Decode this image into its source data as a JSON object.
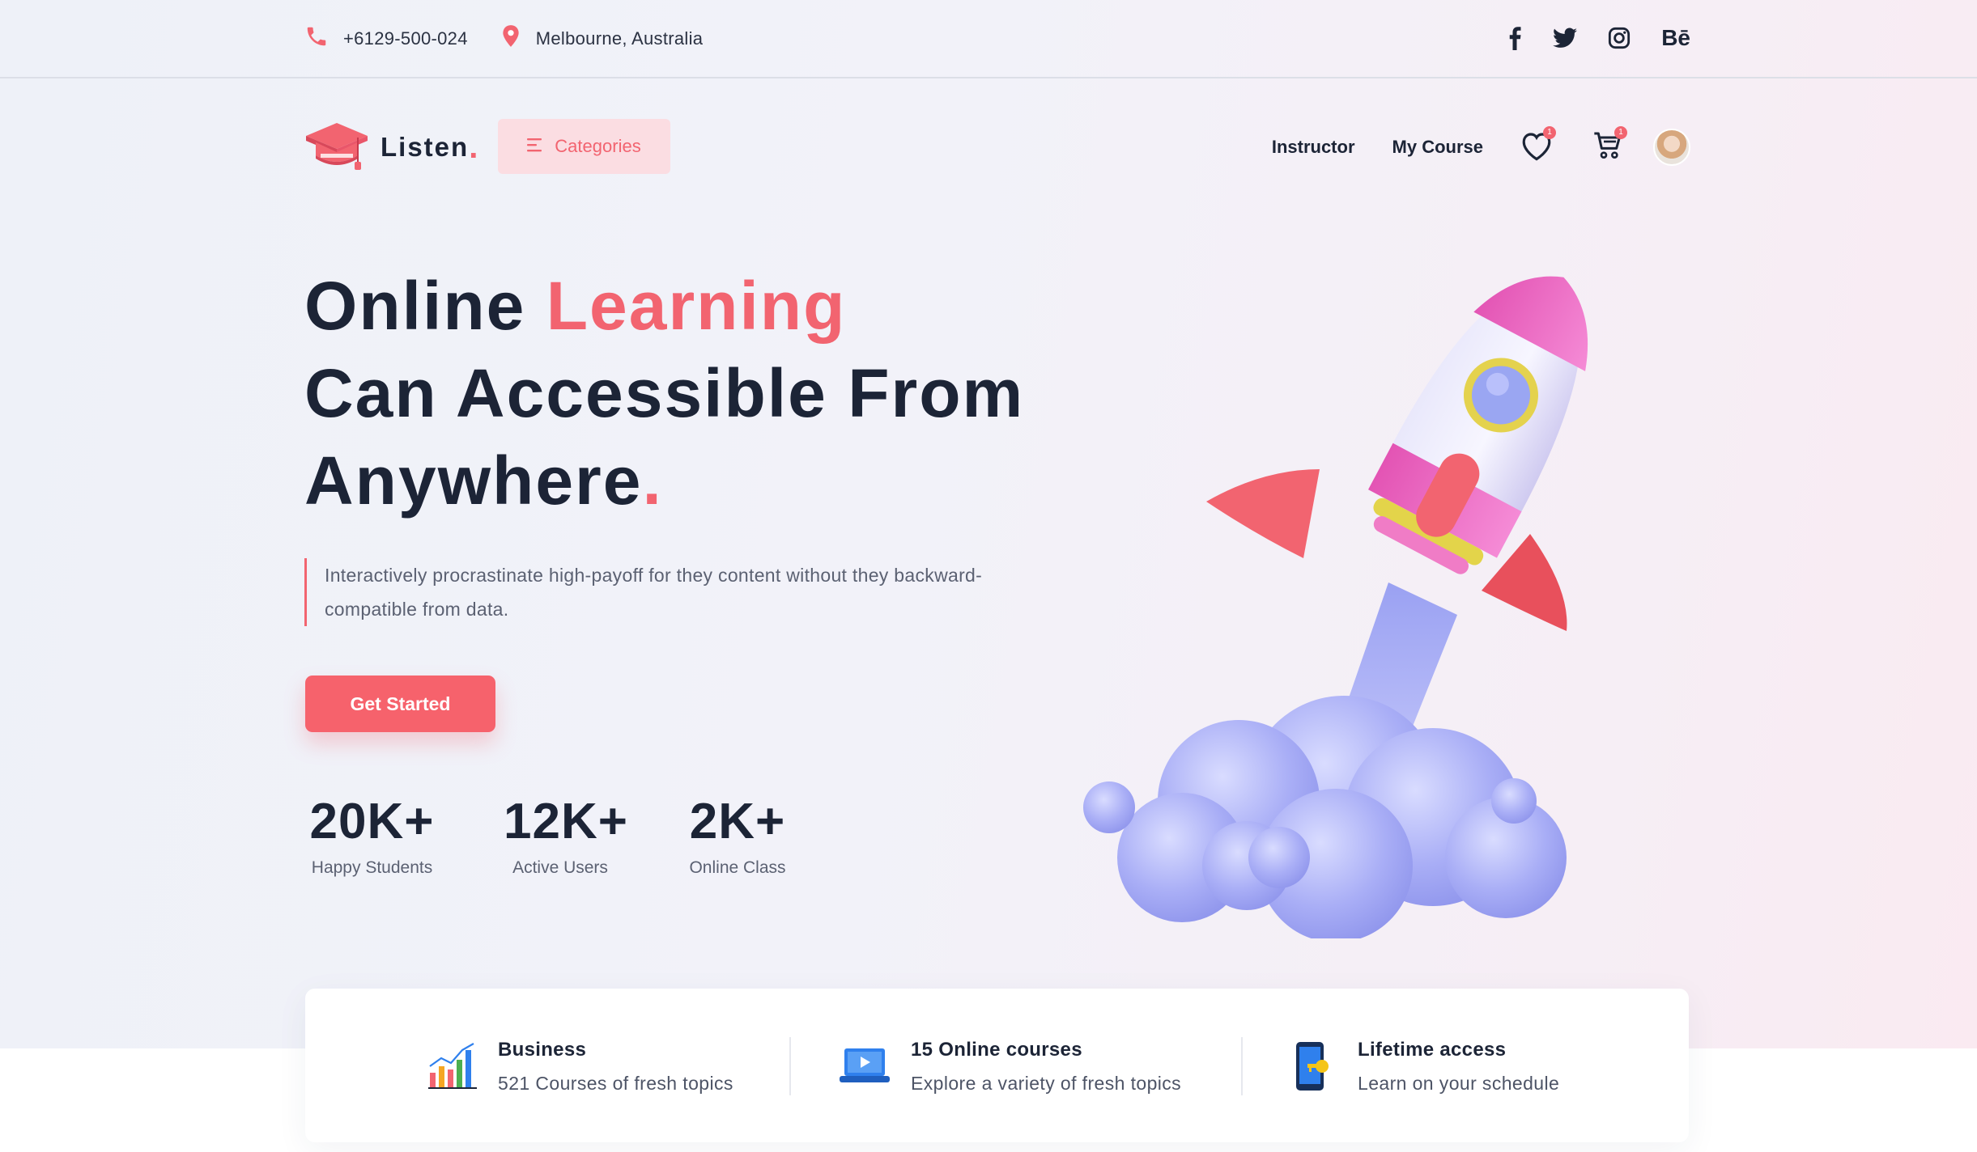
{
  "topbar": {
    "phone": "+6129-500-024",
    "location": "Melbourne, Australia",
    "social": [
      {
        "icon": "facebook-icon",
        "glyph": "f"
      },
      {
        "icon": "twitter-icon",
        "glyph": ""
      },
      {
        "icon": "instagram-icon",
        "glyph": ""
      },
      {
        "icon": "behance-icon",
        "glyph": "Bē"
      }
    ]
  },
  "nav": {
    "brand": "Listen",
    "brand_dot": ".",
    "categories_label": "Categories",
    "links": [
      "Instructor",
      "My Course"
    ],
    "wishlist_count": "1",
    "cart_count": "1"
  },
  "hero": {
    "title_part1": "Online ",
    "title_accent": "Learning",
    "title_line2": "Can Accessible From",
    "title_line3": "Anywhere",
    "title_dot": ".",
    "description": "Interactively procrastinate high-payoff for they content without they  backward-compatible from data.",
    "cta_label": "Get Started",
    "stats": [
      {
        "value": "20K+",
        "label": "Happy Students"
      },
      {
        "value": "12K+",
        "label": "Active Users"
      },
      {
        "value": "2K+",
        "label": "Online Class"
      }
    ]
  },
  "features": [
    {
      "icon": "bar-chart-icon",
      "title": "Business",
      "subtitle": "521 Courses of fresh topics"
    },
    {
      "icon": "laptop-video-icon",
      "title": "15 Online courses",
      "subtitle": "Explore a variety of fresh topics"
    },
    {
      "icon": "mobile-key-icon",
      "title": "Lifetime access",
      "subtitle": "Learn on your schedule"
    }
  ],
  "colors": {
    "accent": "#f26470",
    "heading": "#1c2436",
    "body_text": "#5b6172"
  }
}
